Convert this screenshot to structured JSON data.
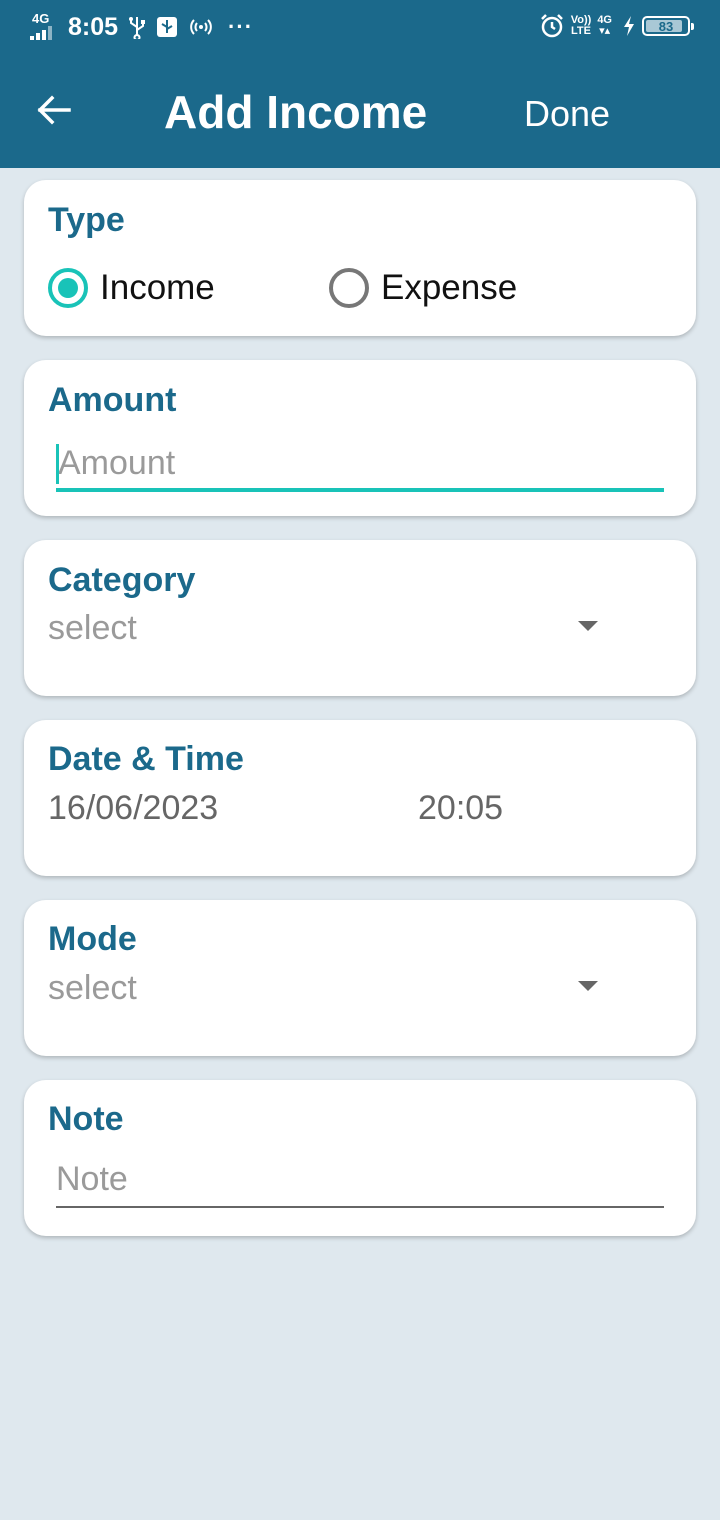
{
  "status_bar": {
    "network_label": "4G",
    "time": "8:05",
    "volte_top": "Vo))",
    "volte_bottom": "LTE",
    "net2_label": "4G",
    "battery_level": "83"
  },
  "app_bar": {
    "title": "Add Income",
    "done_label": "Done"
  },
  "type_card": {
    "label": "Type",
    "options": [
      {
        "label": "Income",
        "checked": true
      },
      {
        "label": "Expense",
        "checked": false
      }
    ]
  },
  "amount_card": {
    "label": "Amount",
    "placeholder": "Amount"
  },
  "category_card": {
    "label": "Category",
    "selected": "select"
  },
  "datetime_card": {
    "label": "Date & Time",
    "date": "16/06/2023",
    "time": "20:05"
  },
  "mode_card": {
    "label": "Mode",
    "selected": "select"
  },
  "note_card": {
    "label": "Note",
    "placeholder": "Note"
  },
  "colors": {
    "primary": "#1b698b",
    "accent": "#19c3b8",
    "background": "#dfe8ee"
  }
}
